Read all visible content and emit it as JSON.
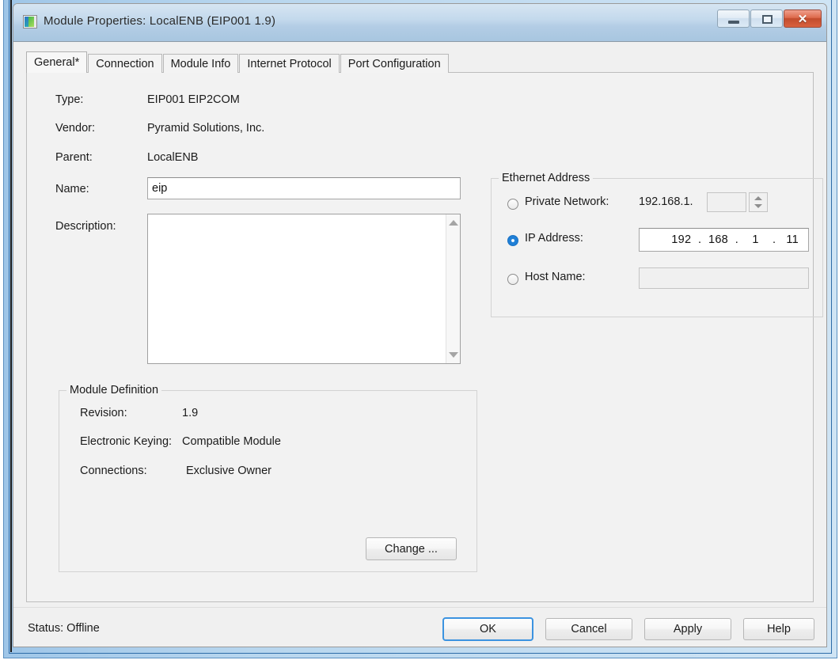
{
  "window": {
    "title": "Module Properties: LocalENB (EIP001 1.9)",
    "icon": "module-icon",
    "minimize_label": "–",
    "maximize_label": "□",
    "close_label": "✕"
  },
  "tabs": [
    {
      "label": "General*",
      "active": true
    },
    {
      "label": "Connection",
      "active": false
    },
    {
      "label": "Module Info",
      "active": false
    },
    {
      "label": "Internet Protocol",
      "active": false
    },
    {
      "label": "Port Configuration",
      "active": false
    }
  ],
  "general": {
    "type_label": "Type:",
    "type_value": "EIP001 EIP2COM",
    "vendor_label": "Vendor:",
    "vendor_value": "Pyramid Solutions, Inc.",
    "parent_label": "Parent:",
    "parent_value": "LocalENB",
    "name_label": "Name:",
    "name_value": "eip",
    "description_label": "Description:",
    "description_value": ""
  },
  "ethernet": {
    "caption": "Ethernet Address",
    "private_network": {
      "label": "Private Network:",
      "prefix": "192.168.1.",
      "octet_value": "",
      "selected": false,
      "enabled": false
    },
    "ip_address": {
      "label": "IP Address:",
      "value": "192  .  168  .    1    .   11",
      "selected": true,
      "enabled": true
    },
    "host_name": {
      "label": "Host Name:",
      "value": "",
      "selected": false,
      "enabled": false
    }
  },
  "module_definition": {
    "caption": "Module Definition",
    "revision_label": "Revision:",
    "revision_value": "1.9",
    "keying_label": "Electronic Keying:",
    "keying_value": "Compatible Module",
    "connections_label": "Connections:",
    "connections_value": "Exclusive Owner",
    "change_button": "Change ..."
  },
  "status": {
    "text": "Status:  Offline"
  },
  "footer_buttons": {
    "ok": "OK",
    "cancel": "Cancel",
    "apply": "Apply",
    "help": "Help"
  },
  "colors": {
    "accent_blue": "#1f7fd6",
    "focus_blue": "#3c93e0",
    "close_red": "#c24c2d",
    "dialog_bg": "#f0f0f0"
  }
}
